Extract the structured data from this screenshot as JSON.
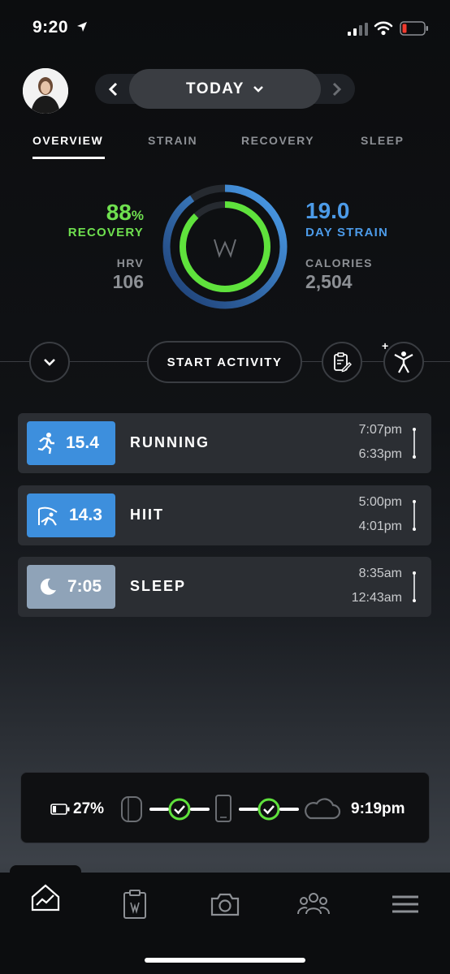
{
  "status_bar": {
    "time": "9:20"
  },
  "date_nav": {
    "label": "TODAY"
  },
  "tabs": [
    {
      "label": "OVERVIEW",
      "active": true
    },
    {
      "label": "STRAIN",
      "active": false
    },
    {
      "label": "RECOVERY",
      "active": false
    },
    {
      "label": "SLEEP",
      "active": false
    }
  ],
  "metrics": {
    "recovery_value": "88",
    "recovery_unit": "%",
    "recovery_label": "RECOVERY",
    "recovery_fraction": 0.88,
    "hrv_label": "HRV",
    "hrv_value": "106",
    "strain_value": "19.0",
    "strain_label": "DAY STRAIN",
    "strain_max": 21,
    "calories_label": "CALORIES",
    "calories_value": "2,504",
    "gauge_logo": "W"
  },
  "actions": {
    "start_label": "START ACTIVITY"
  },
  "activities": [
    {
      "icon": "running-icon",
      "score": "15.4",
      "name": "RUNNING",
      "end": "7:07pm",
      "start": "6:33pm",
      "color": "#3d8fdd"
    },
    {
      "icon": "hiit-icon",
      "score": "14.3",
      "name": "HIIT",
      "end": "5:00pm",
      "start": "4:01pm",
      "color": "#3d8fdd"
    },
    {
      "icon": "moon-icon",
      "score": "7:05",
      "name": "SLEEP",
      "end": "8:35am",
      "start": "12:43am",
      "color": "#8fa3b8"
    }
  ],
  "sync": {
    "battery": "27%",
    "battery_fraction": 0.27,
    "time": "9:19pm"
  },
  "colors": {
    "recovery_green": "#6fe04f",
    "strain_blue": "#4c9be8",
    "muted": "#8d9095"
  }
}
